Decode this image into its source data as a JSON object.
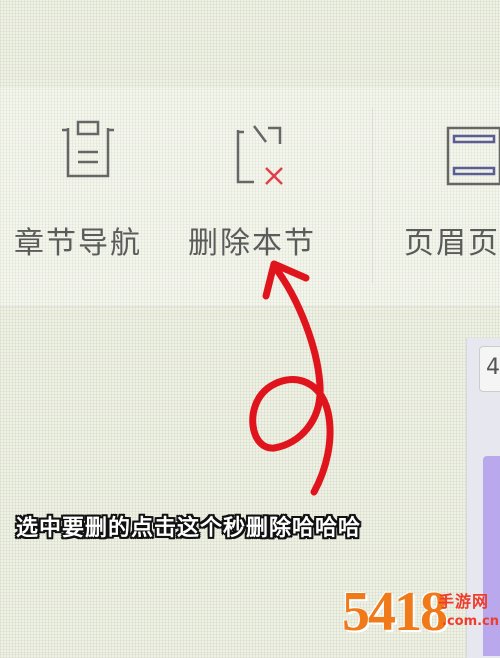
{
  "toolbar": {
    "items": [
      {
        "label": "章节导航",
        "icon": "document-list-icon"
      },
      {
        "label": "删除本节",
        "icon": "delete-section-icon"
      },
      {
        "label": "页眉页",
        "icon": "header-footer-icon"
      }
    ]
  },
  "side_panel": {
    "chip_text": "4"
  },
  "annotation": {
    "caption": "选中要删的点击这个秒删除哈哈哈",
    "arrow_color": "#e0141c"
  },
  "watermark": {
    "number": "5418",
    "site": "手游网",
    "domain": ".com.cn"
  },
  "colors": {
    "icon_stroke": "#666666",
    "delete_x": "#e0404a",
    "header_icon_stroke": "#5b5e93"
  }
}
